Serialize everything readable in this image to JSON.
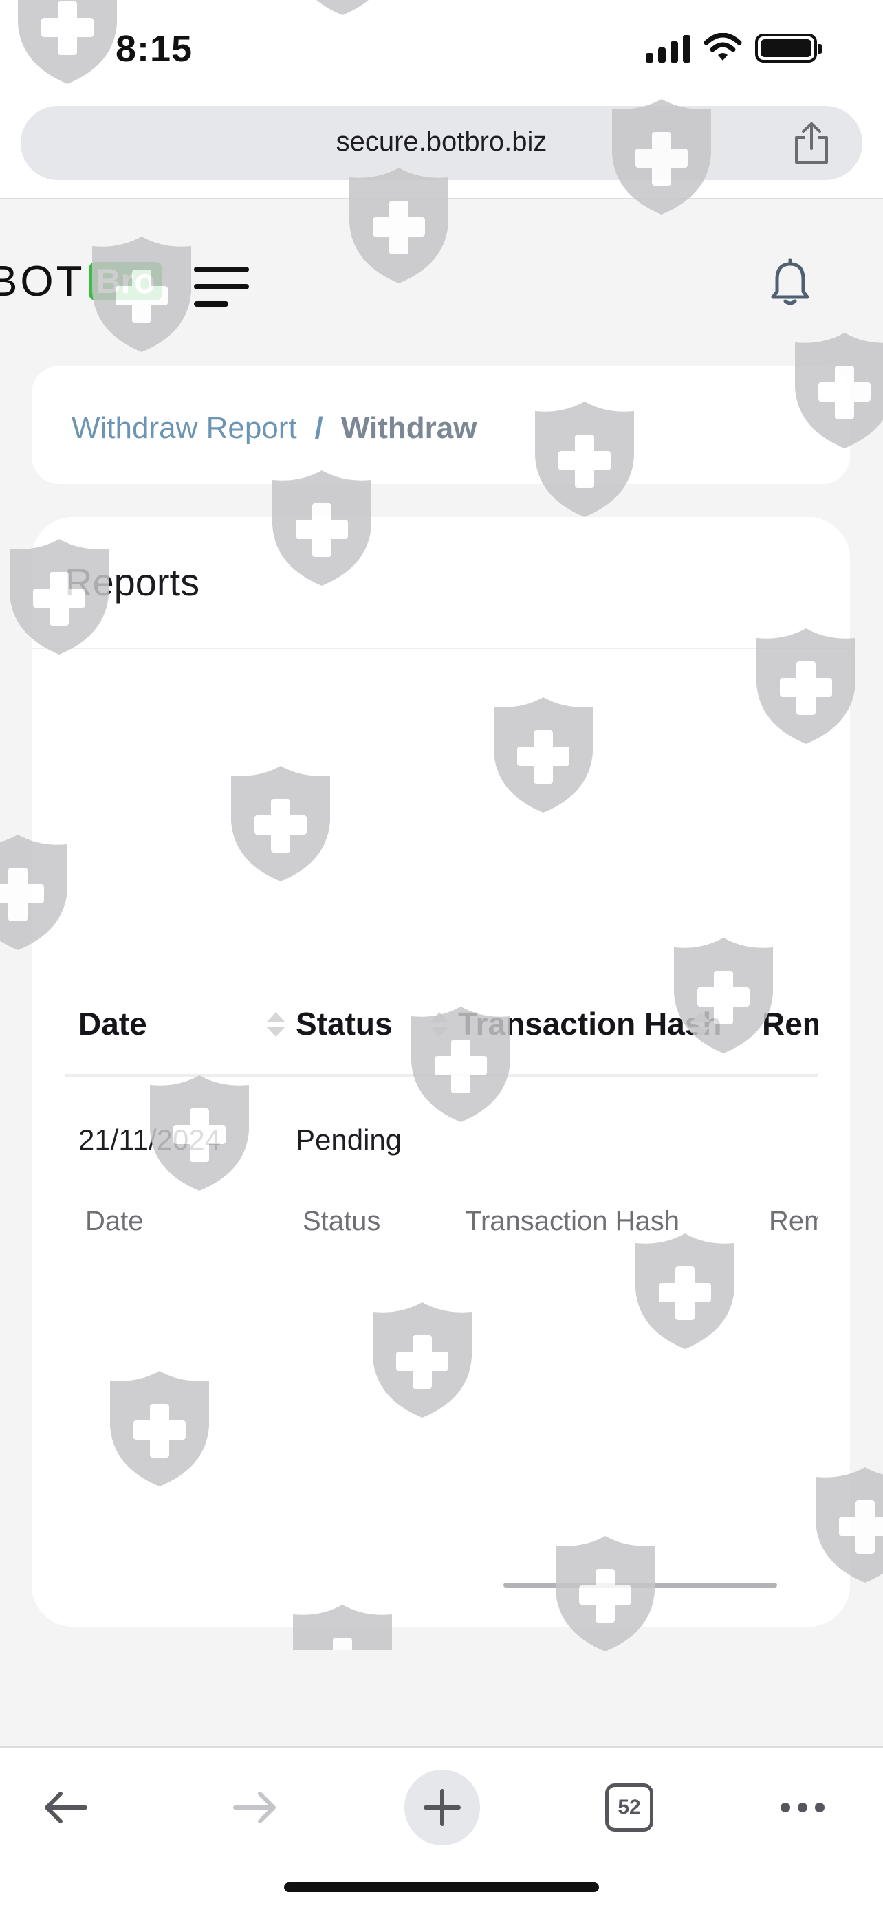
{
  "status_bar": {
    "time": "8:15"
  },
  "browser": {
    "url": "secure.botbro.biz",
    "tab_count": "52"
  },
  "header": {
    "logo_text": "BOT",
    "logo_badge": "Bro"
  },
  "breadcrumb": {
    "parent": "Withdraw Report",
    "separator": "/",
    "current": "Withdraw"
  },
  "report": {
    "title": "Reports",
    "columns": [
      "Date",
      "Status",
      "Transaction Hash",
      "Rem"
    ],
    "rows": [
      {
        "date": "21/11/2024",
        "status": "Pending",
        "hash": "",
        "remark": ""
      }
    ],
    "footer": [
      "Date",
      "Status",
      "Transaction Hash",
      "Rem"
    ]
  },
  "colors": {
    "accent_green": "#3dbb45",
    "link_blue": "#6b95b3"
  }
}
